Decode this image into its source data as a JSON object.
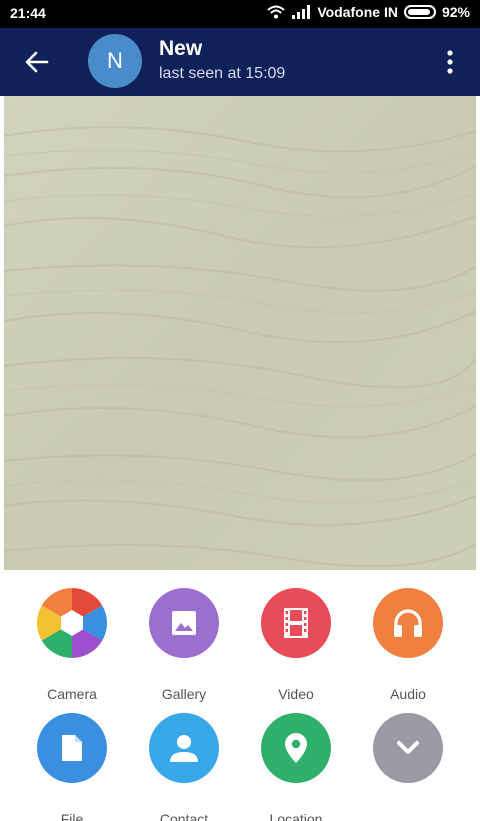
{
  "status_bar": {
    "time": "21:44",
    "carrier": "Vodafone IN",
    "battery_text": "92%",
    "battery_level": 0.92
  },
  "header": {
    "avatar_letter": "N",
    "contact_name": "New",
    "contact_status": "last seen at 15:09",
    "colors": {
      "app_bar": "#102058",
      "avatar": "#4a8bcc"
    }
  },
  "attach_menu": {
    "items": [
      {
        "label": "Camera",
        "icon": "camera-aperture-icon",
        "color": "multicolor"
      },
      {
        "label": "Gallery",
        "icon": "image-icon",
        "color": "#9b6fcf"
      },
      {
        "label": "Video",
        "icon": "film-icon",
        "color": "#e84c5a"
      },
      {
        "label": "Audio",
        "icon": "headphones-icon",
        "color": "#f08040"
      },
      {
        "label": "File",
        "icon": "file-icon",
        "color": "#3a8fe0"
      },
      {
        "label": "Contact",
        "icon": "person-icon",
        "color": "#38a8e8"
      },
      {
        "label": "Location",
        "icon": "map-pin-icon",
        "color": "#2eb06a"
      },
      {
        "label": "",
        "icon": "chevron-down-icon",
        "color": "#9a9aa4"
      }
    ]
  }
}
